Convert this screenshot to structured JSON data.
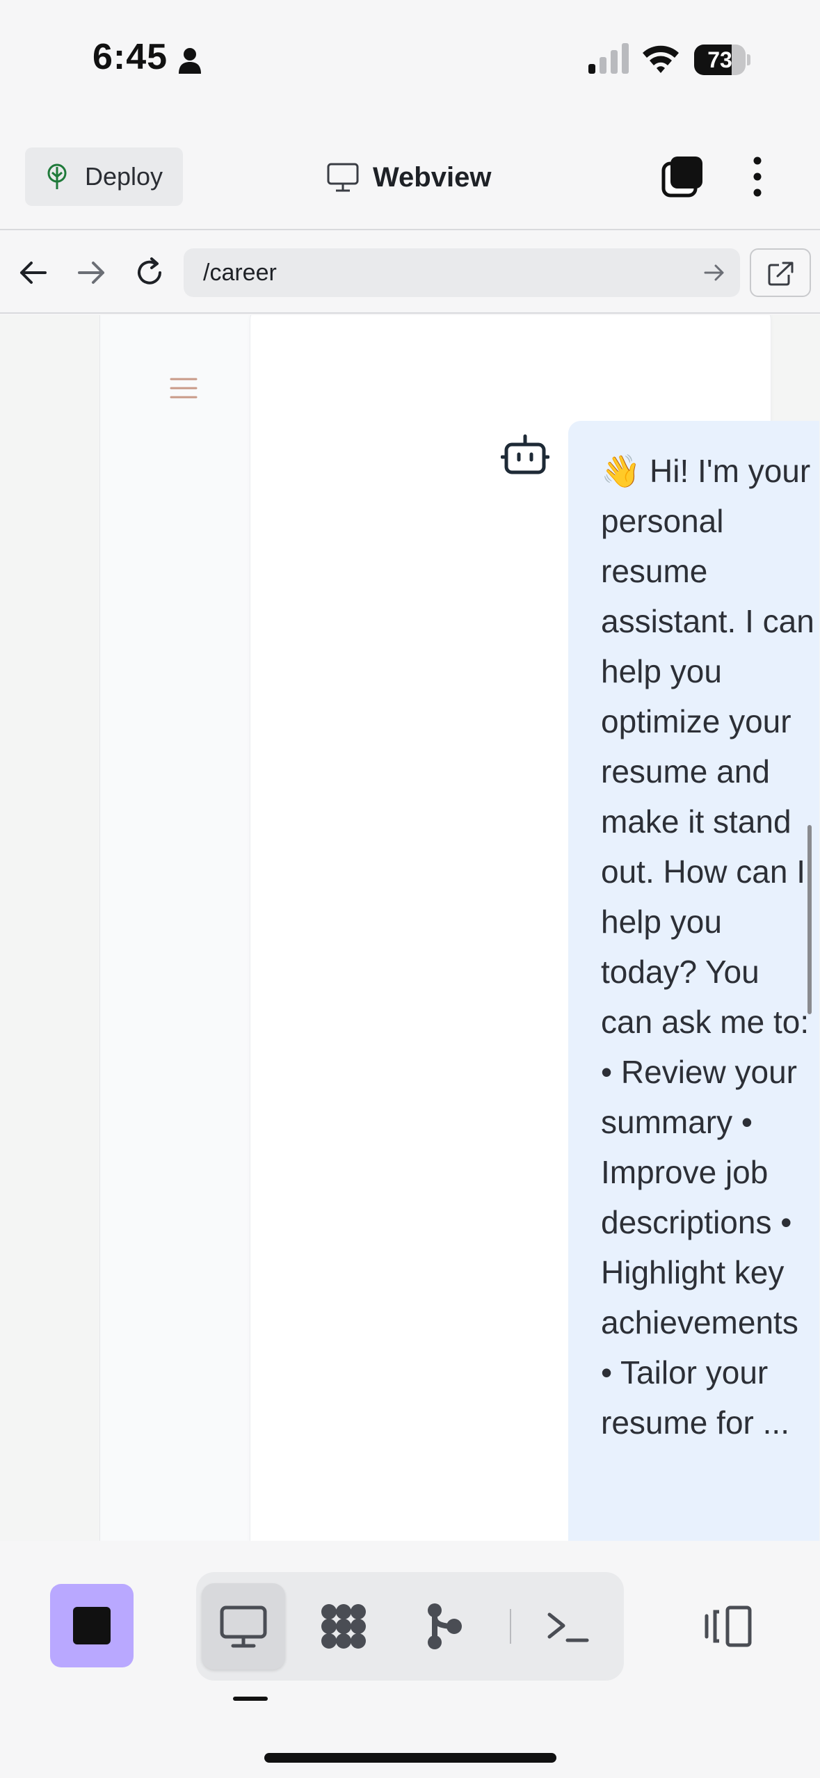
{
  "status_bar": {
    "time": "6:45",
    "battery_percent": "73",
    "battery_level": 0.73,
    "icons": [
      "person-icon",
      "cellular-signal-icon",
      "wifi-icon",
      "battery-icon"
    ]
  },
  "header": {
    "deploy_label": "Deploy",
    "title": "Webview",
    "icons": [
      "deploy-icon",
      "monitor-icon",
      "tabs-icon",
      "more-vertical-icon"
    ]
  },
  "url_bar": {
    "url": "/career",
    "icons": [
      "back-arrow-icon",
      "forward-arrow-icon",
      "reload-icon",
      "go-arrow-icon",
      "open-external-icon"
    ]
  },
  "content": {
    "chat_message": "👋 Hi! I'm your personal resume assistant. I can help you optimize your resume and make it stand out. How can I help you today? You can ask me to: • Review your summary • Improve job descriptions • Highlight key achievements • Tailor your resume for ...",
    "icons": [
      "hamburger-menu-icon",
      "bot-icon"
    ]
  },
  "toolbar": {
    "icons": [
      "stop-icon",
      "monitor-icon",
      "apps-grid-icon",
      "git-branch-icon",
      "terminal-icon",
      "side-panel-icon"
    ],
    "accent_color": "#b9a8ff"
  }
}
